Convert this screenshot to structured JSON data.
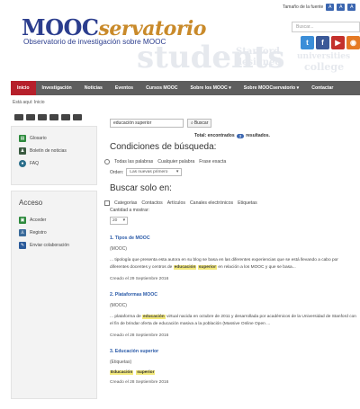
{
  "header": {
    "logo_main": "MOOC",
    "logo_accent": "servatorio",
    "tagline": "Observatorio de investigación sobre MOOC",
    "font_size_label": "Tamaño de la fuente",
    "font_size_buttons": [
      "A",
      "A",
      "A"
    ],
    "search_placeholder": "Buscar...",
    "bg_words": [
      "students",
      "Stanford",
      "designed",
      "universities",
      "college"
    ],
    "social": [
      {
        "name": "twitter-icon",
        "glyph": "t",
        "color": "#3b8ed8"
      },
      {
        "name": "facebook-icon",
        "glyph": "f",
        "color": "#3b5998"
      },
      {
        "name": "youtube-icon",
        "glyph": "▶",
        "color": "#c4302b"
      },
      {
        "name": "rss-icon",
        "glyph": "◉",
        "color": "#e57a24"
      },
      {
        "name": "email-icon",
        "glyph": "✉",
        "color": "#7b89a8"
      }
    ]
  },
  "nav": {
    "items": [
      "Inicio",
      "Investigación",
      "Noticias",
      "Eventos",
      "Cursos MOOC",
      "Sobre los MOOC ▾",
      "Sobre MOOCservatorio ▾",
      "Contactar"
    ],
    "active_index": 0
  },
  "breadcrumb": "Está aquí: Inicio",
  "sidebar": {
    "menu": [
      {
        "label": "Glosario",
        "icon": "book-icon",
        "color": "#2d8a3d"
      },
      {
        "label": "Boletín de noticias",
        "icon": "person-icon",
        "color": "#3a5a40"
      },
      {
        "label": "FAQ",
        "icon": "chat-icon",
        "color": "#2a6e8a"
      }
    ],
    "access_title": "Acceso",
    "access": [
      {
        "label": "Acceder",
        "icon": "lock-icon",
        "color": "#2d8a3d"
      },
      {
        "label": "Registro",
        "icon": "user-icon",
        "color": "#3a6a9a"
      },
      {
        "label": "Enviar colaboración",
        "icon": "pencil-icon",
        "color": "#2a5a9a"
      }
    ]
  },
  "search": {
    "value": "educación superior",
    "button": "Buscar",
    "total_prefix": "Total: encontrados",
    "total_count": "3",
    "total_suffix": "resultados.",
    "conditions_title": "Condiciones de búsqueda:",
    "match_options": [
      "Todas las palabras",
      "Cualquier palabra",
      "Frase exacta"
    ],
    "order_label": "Orden:",
    "order_value": "Las nuevas primero",
    "search_only_title": "Buscar solo en:",
    "areas": [
      "Categorías",
      "Contactos",
      "Artículos",
      "Canales electrónicos",
      "Etiquetas"
    ],
    "limit_label": "Cantidad a mostrar:",
    "limit_value": "20"
  },
  "results": [
    {
      "title": "1. Tipos de MOOC",
      "type": "(MOOC)",
      "pre": "... tipología que presenta esta autora en su blog se basa en las diferentes experiencias que se está llevando a cabo por diferentes docentes y centros de",
      "hl1": "educación",
      "hl2": "superior",
      "post": "en relación a los MOOC y que se basa...",
      "date": "Creado el 29 Septiembre 2016"
    },
    {
      "title": "2. Plataformas MOOC",
      "type": "(MOOC)",
      "pre": "... plataforma de",
      "hl1": "educación",
      "hl2": "",
      "post": "virtual nacida en octubre de 2011 y desarrollada por académicos de la Universidad de Stanford con el fin de brindar oferta de educación masiva a la población (Massive Online Open ...",
      "date": "Creado el 28 Septiembre 2016"
    },
    {
      "title": "3. Educación superior",
      "type": "(Etiquetas)",
      "tags": [
        "Educación",
        "superior"
      ],
      "date": "Creado el 28 Septiembre 2016"
    }
  ]
}
